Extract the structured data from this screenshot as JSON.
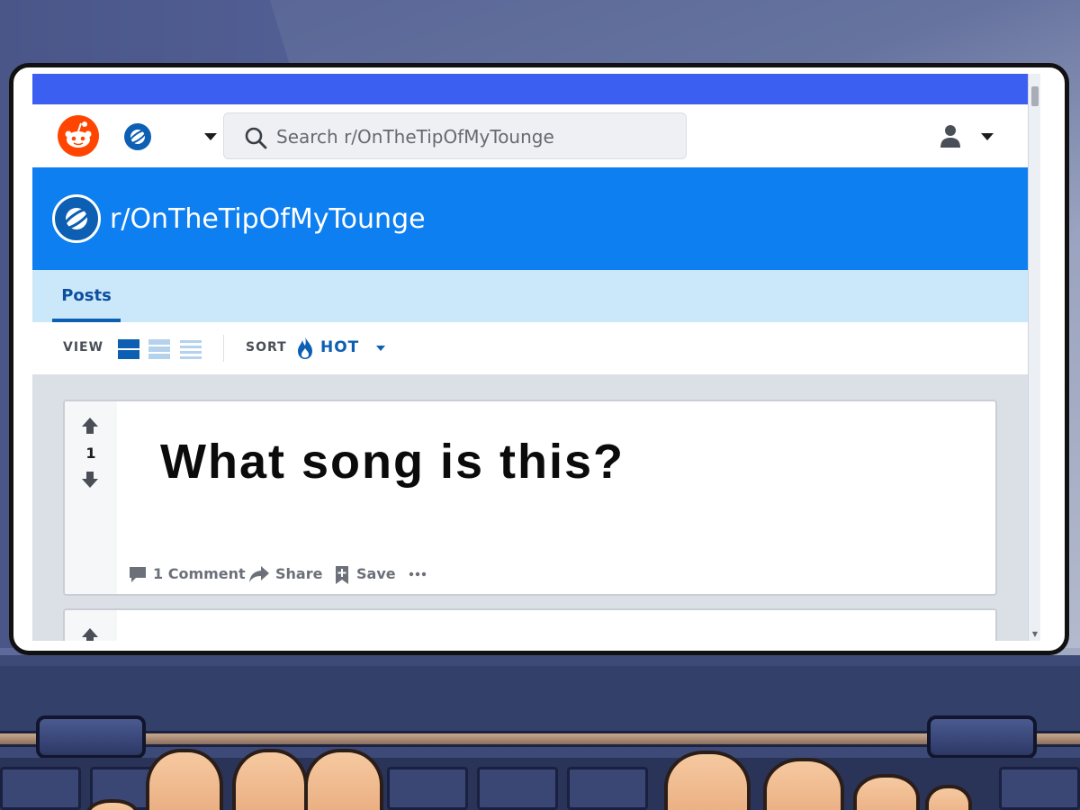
{
  "header": {
    "search": {
      "placeholder": "Search r/OnTheTipOfMyTounge"
    }
  },
  "banner": {
    "title": "r/OnTheTipOfMyTounge"
  },
  "tabs": [
    {
      "label": "Posts",
      "active": true
    }
  ],
  "toolbar": {
    "view_label": "VIEW",
    "view_modes": [
      "card",
      "classic",
      "compact"
    ],
    "selected_view": "card",
    "sort_label": "SORT",
    "sort_value": "HOT"
  },
  "post": {
    "votes": "1",
    "title": "What song is this?",
    "actions": {
      "comments": "1 Comment",
      "share": "Share",
      "save": "Save"
    }
  },
  "colors": {
    "browser_bar": "#3b5ff0",
    "banner": "#0e7ff0",
    "tabs_bg": "#cbe8fb",
    "accent": "#0d5fb4",
    "reddit_orange": "#ff4500"
  },
  "icons": [
    "reddit-logo-icon",
    "subreddit-icon",
    "search-icon",
    "user-icon",
    "fire-icon",
    "upvote-icon",
    "downvote-icon",
    "comment-icon",
    "share-icon",
    "save-icon",
    "more-icon"
  ]
}
